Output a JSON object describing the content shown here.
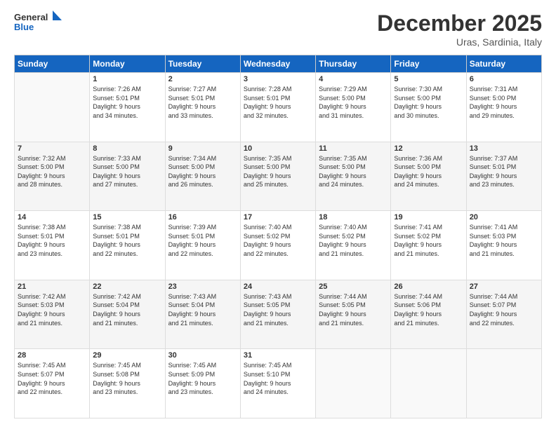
{
  "header": {
    "logo_general": "General",
    "logo_blue": "Blue",
    "month": "December 2025",
    "location": "Uras, Sardinia, Italy"
  },
  "days_of_week": [
    "Sunday",
    "Monday",
    "Tuesday",
    "Wednesday",
    "Thursday",
    "Friday",
    "Saturday"
  ],
  "weeks": [
    [
      {
        "day": "",
        "info": ""
      },
      {
        "day": "1",
        "info": "Sunrise: 7:26 AM\nSunset: 5:01 PM\nDaylight: 9 hours\nand 34 minutes."
      },
      {
        "day": "2",
        "info": "Sunrise: 7:27 AM\nSunset: 5:01 PM\nDaylight: 9 hours\nand 33 minutes."
      },
      {
        "day": "3",
        "info": "Sunrise: 7:28 AM\nSunset: 5:01 PM\nDaylight: 9 hours\nand 32 minutes."
      },
      {
        "day": "4",
        "info": "Sunrise: 7:29 AM\nSunset: 5:00 PM\nDaylight: 9 hours\nand 31 minutes."
      },
      {
        "day": "5",
        "info": "Sunrise: 7:30 AM\nSunset: 5:00 PM\nDaylight: 9 hours\nand 30 minutes."
      },
      {
        "day": "6",
        "info": "Sunrise: 7:31 AM\nSunset: 5:00 PM\nDaylight: 9 hours\nand 29 minutes."
      }
    ],
    [
      {
        "day": "7",
        "info": "Sunrise: 7:32 AM\nSunset: 5:00 PM\nDaylight: 9 hours\nand 28 minutes."
      },
      {
        "day": "8",
        "info": "Sunrise: 7:33 AM\nSunset: 5:00 PM\nDaylight: 9 hours\nand 27 minutes."
      },
      {
        "day": "9",
        "info": "Sunrise: 7:34 AM\nSunset: 5:00 PM\nDaylight: 9 hours\nand 26 minutes."
      },
      {
        "day": "10",
        "info": "Sunrise: 7:35 AM\nSunset: 5:00 PM\nDaylight: 9 hours\nand 25 minutes."
      },
      {
        "day": "11",
        "info": "Sunrise: 7:35 AM\nSunset: 5:00 PM\nDaylight: 9 hours\nand 24 minutes."
      },
      {
        "day": "12",
        "info": "Sunrise: 7:36 AM\nSunset: 5:00 PM\nDaylight: 9 hours\nand 24 minutes."
      },
      {
        "day": "13",
        "info": "Sunrise: 7:37 AM\nSunset: 5:01 PM\nDaylight: 9 hours\nand 23 minutes."
      }
    ],
    [
      {
        "day": "14",
        "info": "Sunrise: 7:38 AM\nSunset: 5:01 PM\nDaylight: 9 hours\nand 23 minutes."
      },
      {
        "day": "15",
        "info": "Sunrise: 7:38 AM\nSunset: 5:01 PM\nDaylight: 9 hours\nand 22 minutes."
      },
      {
        "day": "16",
        "info": "Sunrise: 7:39 AM\nSunset: 5:01 PM\nDaylight: 9 hours\nand 22 minutes."
      },
      {
        "day": "17",
        "info": "Sunrise: 7:40 AM\nSunset: 5:02 PM\nDaylight: 9 hours\nand 22 minutes."
      },
      {
        "day": "18",
        "info": "Sunrise: 7:40 AM\nSunset: 5:02 PM\nDaylight: 9 hours\nand 21 minutes."
      },
      {
        "day": "19",
        "info": "Sunrise: 7:41 AM\nSunset: 5:02 PM\nDaylight: 9 hours\nand 21 minutes."
      },
      {
        "day": "20",
        "info": "Sunrise: 7:41 AM\nSunset: 5:03 PM\nDaylight: 9 hours\nand 21 minutes."
      }
    ],
    [
      {
        "day": "21",
        "info": "Sunrise: 7:42 AM\nSunset: 5:03 PM\nDaylight: 9 hours\nand 21 minutes."
      },
      {
        "day": "22",
        "info": "Sunrise: 7:42 AM\nSunset: 5:04 PM\nDaylight: 9 hours\nand 21 minutes."
      },
      {
        "day": "23",
        "info": "Sunrise: 7:43 AM\nSunset: 5:04 PM\nDaylight: 9 hours\nand 21 minutes."
      },
      {
        "day": "24",
        "info": "Sunrise: 7:43 AM\nSunset: 5:05 PM\nDaylight: 9 hours\nand 21 minutes."
      },
      {
        "day": "25",
        "info": "Sunrise: 7:44 AM\nSunset: 5:05 PM\nDaylight: 9 hours\nand 21 minutes."
      },
      {
        "day": "26",
        "info": "Sunrise: 7:44 AM\nSunset: 5:06 PM\nDaylight: 9 hours\nand 21 minutes."
      },
      {
        "day": "27",
        "info": "Sunrise: 7:44 AM\nSunset: 5:07 PM\nDaylight: 9 hours\nand 22 minutes."
      }
    ],
    [
      {
        "day": "28",
        "info": "Sunrise: 7:45 AM\nSunset: 5:07 PM\nDaylight: 9 hours\nand 22 minutes."
      },
      {
        "day": "29",
        "info": "Sunrise: 7:45 AM\nSunset: 5:08 PM\nDaylight: 9 hours\nand 23 minutes."
      },
      {
        "day": "30",
        "info": "Sunrise: 7:45 AM\nSunset: 5:09 PM\nDaylight: 9 hours\nand 23 minutes."
      },
      {
        "day": "31",
        "info": "Sunrise: 7:45 AM\nSunset: 5:10 PM\nDaylight: 9 hours\nand 24 minutes."
      },
      {
        "day": "",
        "info": ""
      },
      {
        "day": "",
        "info": ""
      },
      {
        "day": "",
        "info": ""
      }
    ]
  ]
}
